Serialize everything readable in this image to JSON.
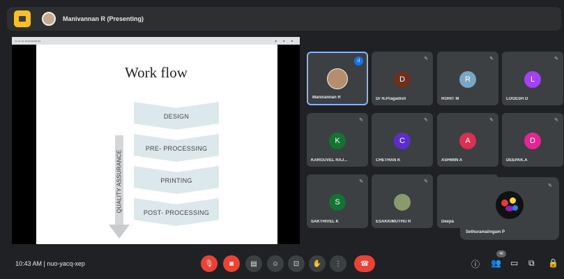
{
  "top_bar": {
    "presenter_label": "Manivannan R (Presenting)"
  },
  "slide": {
    "title": "Work flow",
    "steps": [
      "DESIGN",
      "PRE- PROCESSING",
      "PRINTING",
      "POST- PROCESSING"
    ],
    "side_label": "QUALITY ASSURANCE"
  },
  "participants": [
    {
      "name": "Manivannan R",
      "initial": "",
      "color": "#b58e6e",
      "state": "speaking"
    },
    {
      "name": "Dr N.Pragadish",
      "initial": "D",
      "color": "#6d2f1e",
      "state": "muted"
    },
    {
      "name": "ROHIT M",
      "initial": "R",
      "color": "#7aa6c6",
      "state": "muted"
    },
    {
      "name": "LOGESH D",
      "initial": "L",
      "color": "#a142f4",
      "state": "muted"
    },
    {
      "name": "KARGUVEL RAJ...",
      "initial": "K",
      "color": "#137333",
      "state": "muted"
    },
    {
      "name": "CHETHAN K",
      "initial": "C",
      "color": "#5b2ecb",
      "state": "muted"
    },
    {
      "name": "ASHWIN A",
      "initial": "A",
      "color": "#d93054",
      "state": "muted"
    },
    {
      "name": "DEEPAK.A",
      "initial": "D",
      "color": "#e52592",
      "state": "muted"
    },
    {
      "name": "SAKTHIVEL K",
      "initial": "S",
      "color": "#137333",
      "state": "muted"
    },
    {
      "name": "ESAKKIMUTHU R",
      "initial": "",
      "color": "#8a9a6d",
      "state": "muted"
    },
    {
      "name": "Deepa",
      "initial": "",
      "color": "#3c4043",
      "state": "muted"
    }
  ],
  "self_tile": {
    "name": "Sethuramalingam P"
  },
  "bottom_bar": {
    "clock_meeting": "10:43 AM | nuo-yacq-xep",
    "participant_count": "46"
  }
}
